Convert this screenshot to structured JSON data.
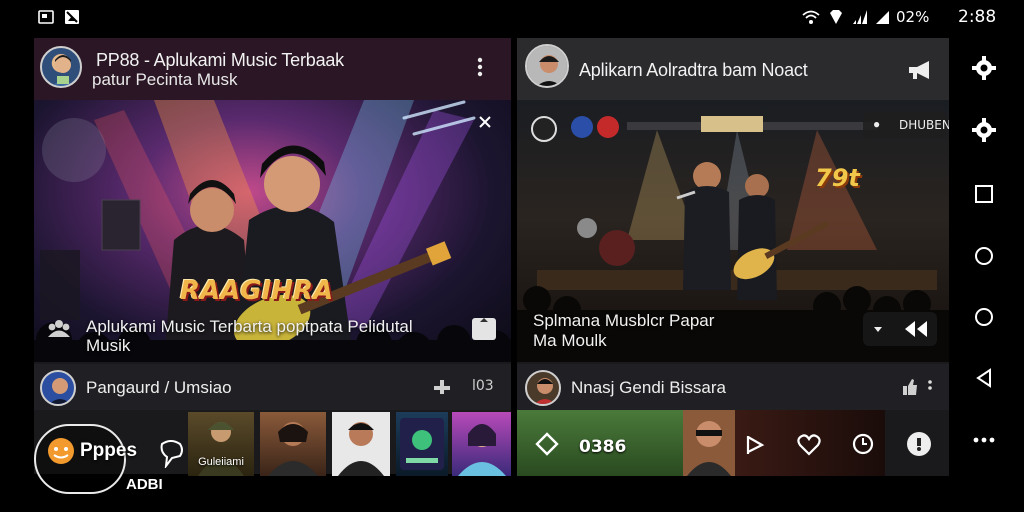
{
  "status_bar": {
    "battery_text": "02%",
    "time": "2:88"
  },
  "left_card": {
    "title_line1": "PP88 - Aplukami Music Terbaak",
    "title_line2": "patur Pecinta Musk",
    "hero_logo": "RAAGIHRA",
    "hero_caption_line1": "Aplukami Music Terbarta poptpata Pelidutal",
    "hero_caption_line2": "Musik",
    "row_title": "Pangaurd / Umsiao",
    "row_count": "l03",
    "thumbs": [
      {
        "label": "Guleiiami"
      },
      {
        "label": ""
      },
      {
        "label": ""
      },
      {
        "label": ""
      },
      {
        "label": ""
      }
    ]
  },
  "right_card": {
    "title": "Aplikarn Aolradtra bam Noact",
    "hero_sign": "DHUBENI",
    "hero_badge": "79t",
    "hero_caption_line1": "Splmana Musblcr Papar",
    "hero_caption_line2": "Ma Moulk",
    "row_title": "Nnasj Gendi Bissara",
    "player_time": "0386"
  },
  "floating": {
    "line1": "Pppes",
    "line2": "ADBI"
  },
  "colors": {
    "accent_yellow": "#f2c84b",
    "card_bg": "#1a1a1c",
    "header_left": "#2a1624",
    "header_right": "#2b2b2e"
  }
}
